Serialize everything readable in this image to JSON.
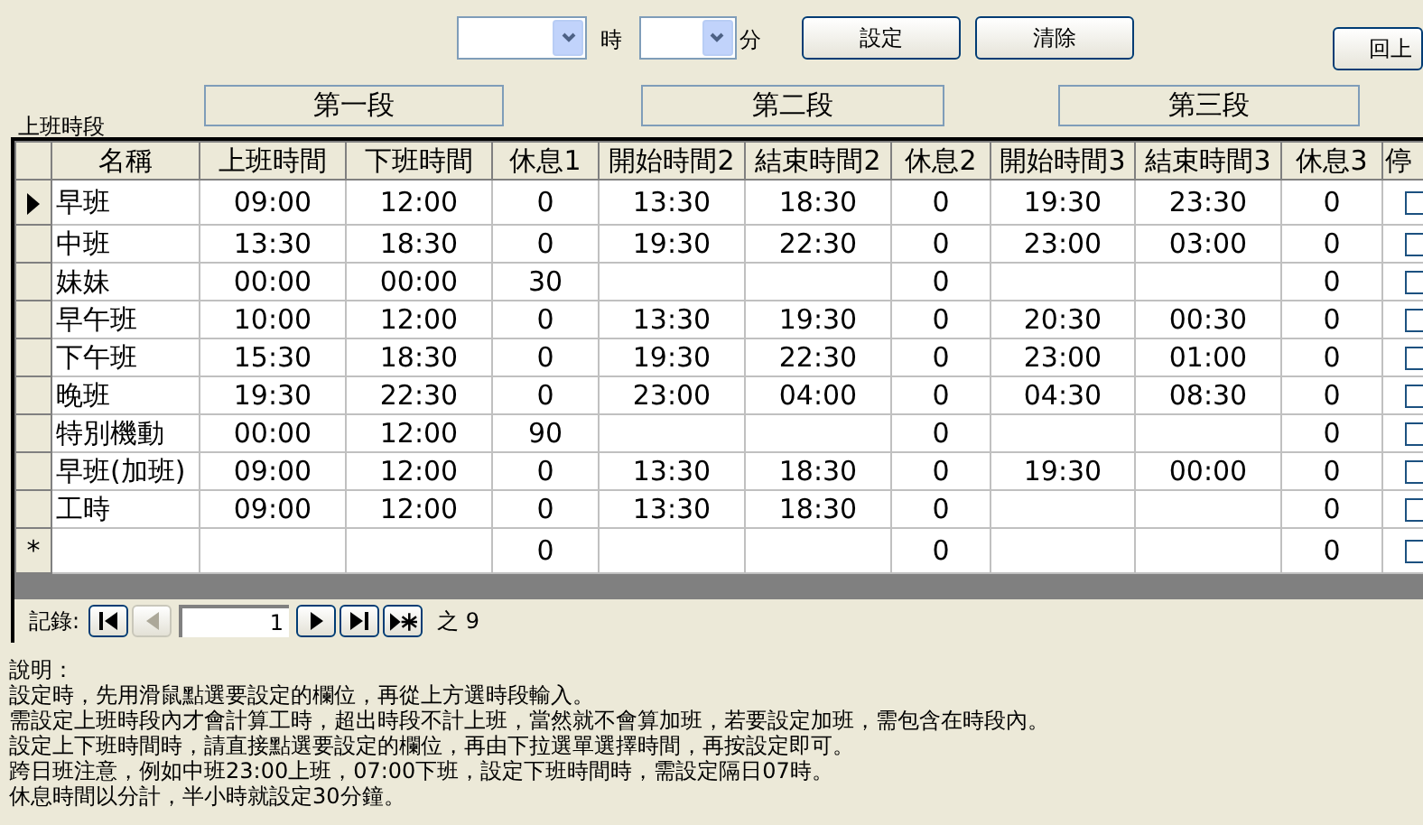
{
  "time_picker": {
    "hour_label": "時",
    "minute_label": "分"
  },
  "buttons": [
    {
      "label": "設定",
      "kind": "action"
    },
    {
      "label": "清除",
      "kind": "action"
    },
    {
      "label": "回上",
      "kind": "back"
    }
  ],
  "segments": [
    "第一段",
    "第二段",
    "第三段"
  ],
  "table": {
    "title": "上班時段",
    "columns": [
      "名稱",
      "上班時間",
      "下班時間",
      "休息1",
      "開始時間2",
      "結束時間2",
      "休息2",
      "開始時間3",
      "結束時間3",
      "休息3",
      "停"
    ],
    "rows": [
      {
        "selected": true,
        "kind": "record",
        "cells": [
          "早班",
          "09:00",
          "12:00",
          "0",
          "13:30",
          "18:30",
          "0",
          "19:30",
          "23:30",
          "0"
        ],
        "checked": false
      },
      {
        "selected": false,
        "kind": "record",
        "cells": [
          "中班",
          "13:30",
          "18:30",
          "0",
          "19:30",
          "22:30",
          "0",
          "23:00",
          "03:00",
          "0"
        ],
        "checked": false
      },
      {
        "selected": false,
        "kind": "record",
        "cells": [
          "妹妹",
          "00:00",
          "00:00",
          "30",
          null,
          null,
          "0",
          null,
          null,
          "0"
        ],
        "checked": false
      },
      {
        "selected": false,
        "kind": "record",
        "cells": [
          "早午班",
          "10:00",
          "12:00",
          "0",
          "13:30",
          "19:30",
          "0",
          "20:30",
          "00:30",
          "0"
        ],
        "checked": false
      },
      {
        "selected": false,
        "kind": "record",
        "cells": [
          "下午班",
          "15:30",
          "18:30",
          "0",
          "19:30",
          "22:30",
          "0",
          "23:00",
          "01:00",
          "0"
        ],
        "checked": false
      },
      {
        "selected": false,
        "kind": "record",
        "cells": [
          "晚班",
          "19:30",
          "22:30",
          "0",
          "23:00",
          "04:00",
          "0",
          "04:30",
          "08:30",
          "0"
        ],
        "checked": false
      },
      {
        "selected": false,
        "kind": "record",
        "cells": [
          "特別機動",
          "00:00",
          "12:00",
          "90",
          null,
          null,
          "0",
          null,
          null,
          "0"
        ],
        "checked": false
      },
      {
        "selected": false,
        "kind": "record",
        "cells": [
          "早班(加班)",
          "09:00",
          "12:00",
          "0",
          "13:30",
          "18:30",
          "0",
          "19:30",
          "00:00",
          "0"
        ],
        "checked": false
      },
      {
        "selected": false,
        "kind": "record",
        "cells": [
          "工時",
          "09:00",
          "12:00",
          "0",
          "13:30",
          "18:30",
          "0",
          null,
          null,
          "0"
        ],
        "checked": false
      },
      {
        "selected": false,
        "kind": "new",
        "marker": "*",
        "cells": [
          null,
          null,
          null,
          "0",
          null,
          null,
          "0",
          null,
          null,
          "0"
        ],
        "checked": false
      }
    ]
  },
  "navigator": {
    "label": "記錄:",
    "record": "1",
    "of_label": "之",
    "total": "9",
    "buttons": [
      {
        "kind": "first",
        "disabled": false
      },
      {
        "kind": "prev",
        "disabled": true
      },
      {
        "kind": "next",
        "disabled": false
      },
      {
        "kind": "last",
        "disabled": false
      },
      {
        "kind": "new",
        "disabled": false
      }
    ]
  },
  "notes": {
    "title": "說明：",
    "lines": [
      "設定時，先用滑鼠點選要設定的欄位，再從上方選時段輸入。",
      "需設定上班時段內才會計算工時，超出時段不計上班，當然就不會算加班，若要設定加班，需包含在時段內。",
      "設定上下班時間時，請直接點選要設定的欄位，再由下拉選單選擇時間，再按設定即可。",
      "跨日班注意，例如中班23:00上班，07:00下班，設定下班時間時，需設定隔日07時。",
      "休息時間以分計，半小時就設定30分鐘。"
    ]
  }
}
